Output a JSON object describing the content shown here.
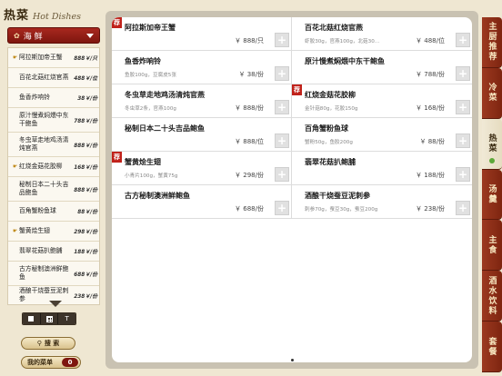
{
  "brand": {
    "title_cn": "热菜",
    "title_en": "Hot Dishes"
  },
  "category": {
    "icon": "fish-icon",
    "label": "海 鲜"
  },
  "dish_list": [
    {
      "name": "阿拉斯加帝王蟹",
      "price": "888￥/只",
      "flag": true
    },
    {
      "name": "百花北菇红烧官燕",
      "price": "488￥/位",
      "flag": false
    },
    {
      "name": "鱼香炸响铃",
      "price": "38￥/份",
      "flag": false
    },
    {
      "name": "原汁慢煮焖煨中东干鲍鱼",
      "price": "788￥/份",
      "flag": false
    },
    {
      "name": "冬虫草走地鸡汤清炖官燕",
      "price": "888￥/份",
      "flag": false
    },
    {
      "name": "红烧金菇花胶柳",
      "price": "168￥/份",
      "flag": true
    },
    {
      "name": "秘制日本二十头吉品鲍鱼",
      "price": "888￥/份",
      "flag": false
    },
    {
      "name": "百角蟹粉鱼球",
      "price": "88￥/份",
      "flag": false
    },
    {
      "name": "蟹黄烩生翅",
      "price": "298￥/份",
      "flag": true
    },
    {
      "name": "翡翠花菇扒鲍脯",
      "price": "188￥/份",
      "flag": false
    },
    {
      "name": "古方秘制澳洲鲜鲍鱼",
      "price": "688￥/份",
      "flag": false
    },
    {
      "name": "酒酿干烧蚕豆泥刺参",
      "price": "238￥/份",
      "flag": false
    }
  ],
  "view_toggle": [
    "single",
    "grid",
    "text"
  ],
  "buttons": {
    "search": "搜 索",
    "my_menu": "我的菜单",
    "my_menu_count": "0"
  },
  "cards": [
    {
      "title": "阿拉斯加帝王蟹",
      "desc": "",
      "price": "￥ 888/只",
      "rec": true
    },
    {
      "title": "百花北菇红烧官燕",
      "desc": "虾胶30g，官燕100g，北菇30...",
      "price": "￥ 488/位",
      "rec": false
    },
    {
      "title": "鱼香炸响铃",
      "desc": "鱼胶100g，豆腐皮5张",
      "price": "￥ 38/份",
      "rec": false
    },
    {
      "title": "原汁慢煮焖煨中东干鲍鱼",
      "desc": "",
      "price": "￥ 788/份",
      "rec": false
    },
    {
      "title": "冬虫草走地鸡汤清炖官燕",
      "desc": "冬虫草2条，官燕100g",
      "price": "￥ 888/份",
      "rec": false
    },
    {
      "title": "红烧金菇花胶柳",
      "desc": "金针菇80g，花胶150g",
      "price": "￥ 168/份",
      "rec": true
    },
    {
      "title": "秘制日本二十头吉品鲍鱼",
      "desc": "",
      "price": "￥ 888/位",
      "rec": false
    },
    {
      "title": "百角蟹粉鱼球",
      "desc": "蟹粉50g，鱼胶200g",
      "price": "￥ 88/份",
      "rec": false
    },
    {
      "title": "蟹黄烩生翅",
      "desc": "小青片100g，蟹黄75g",
      "price": "￥ 298/份",
      "rec": true
    },
    {
      "title": "翡翠花菇扒鲍脯",
      "desc": "",
      "price": "￥ 188/份",
      "rec": false
    },
    {
      "title": "古方秘制澳洲鲜鲍鱼",
      "desc": "",
      "price": "￥ 688/份",
      "rec": false
    },
    {
      "title": "酒酿干烧蚕豆泥刺参",
      "desc": "刺参70g，蚕豆30g，蚕豆200g",
      "price": "￥ 238/份",
      "rec": false
    }
  ],
  "rec_badge": "荐",
  "add_label": "+",
  "right_tabs": [
    "主厨推荐",
    "冷菜",
    "热菜",
    "汤羹",
    "主食",
    "酒水饮料",
    "套餐"
  ],
  "active_tab": "热菜"
}
